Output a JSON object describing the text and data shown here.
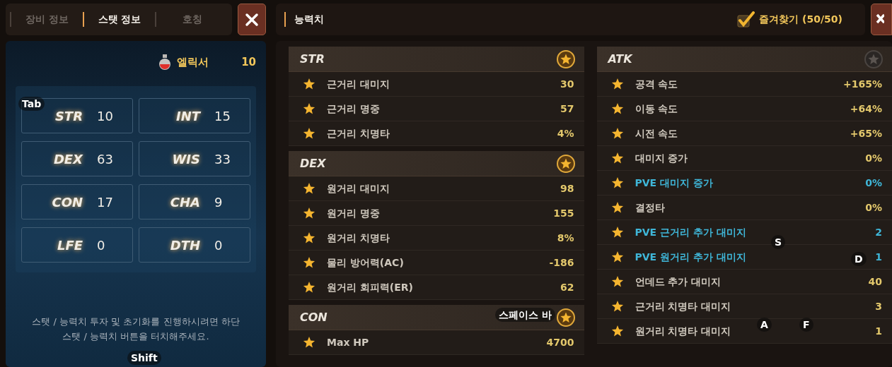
{
  "left_panel": {
    "tabs": [
      {
        "label": "장비 정보",
        "selected": false
      },
      {
        "label": "스탯 정보",
        "selected": true
      },
      {
        "label": "호칭",
        "selected": false
      }
    ],
    "elixir": {
      "label": "엘릭서",
      "count": "10"
    },
    "stats": [
      {
        "name": "STR",
        "value": "10"
      },
      {
        "name": "INT",
        "value": "15"
      },
      {
        "name": "DEX",
        "value": "63"
      },
      {
        "name": "WIS",
        "value": "33"
      },
      {
        "name": "CON",
        "value": "17"
      },
      {
        "name": "CHA",
        "value": "9"
      },
      {
        "name": "LFE",
        "value": "0"
      },
      {
        "name": "DTH",
        "value": "0"
      }
    ],
    "notice": "스탯 / 능력치 투자 및 초기화를 진행하시려면 하단 스탯 / 능력치 버튼을 터치해주세요."
  },
  "right_panel": {
    "title": "능력치",
    "favorites": {
      "label": "즐겨찾기 (50/50)",
      "checked": true
    },
    "columns": [
      [
        {
          "name": "STR",
          "favorite": true,
          "rows": [
            {
              "label": "근거리 대미지",
              "value": "30",
              "kind": "normal"
            },
            {
              "label": "근거리 명중",
              "value": "57",
              "kind": "normal"
            },
            {
              "label": "근거리 치명타",
              "value": "4%",
              "kind": "normal"
            }
          ]
        },
        {
          "name": "DEX",
          "favorite": true,
          "rows": [
            {
              "label": "원거리 대미지",
              "value": "98",
              "kind": "normal"
            },
            {
              "label": "원거리 명중",
              "value": "155",
              "kind": "normal"
            },
            {
              "label": "원거리 치명타",
              "value": "8%",
              "kind": "normal"
            },
            {
              "label": "물리 방어력(AC)",
              "value": "-186",
              "kind": "normal"
            },
            {
              "label": "원거리 회피력(ER)",
              "value": "62",
              "kind": "normal"
            }
          ]
        },
        {
          "name": "CON",
          "favorite": true,
          "rows": [
            {
              "label": "Max HP",
              "value": "4700",
              "kind": "normal"
            }
          ]
        }
      ],
      [
        {
          "name": "ATK",
          "favorite": false,
          "rows": [
            {
              "label": "공격 속도",
              "value": "+165%",
              "kind": "normal"
            },
            {
              "label": "이동 속도",
              "value": "+64%",
              "kind": "normal"
            },
            {
              "label": "시전 속도",
              "value": "+65%",
              "kind": "normal"
            },
            {
              "label": "대미지 증가",
              "value": "0%",
              "kind": "normal"
            },
            {
              "label": "PVE 대미지 증가",
              "value": "0%",
              "kind": "pve"
            },
            {
              "label": "결정타",
              "value": "0%",
              "kind": "normal"
            },
            {
              "label": "PVE 근거리 추가 대미지",
              "value": "2",
              "kind": "pve"
            },
            {
              "label": "PVE 원거리 추가 대미지",
              "value": "1",
              "kind": "pve"
            },
            {
              "label": "언데드 추가 대미지",
              "value": "40",
              "kind": "normal"
            },
            {
              "label": "근거리 치명타 대미지",
              "value": "3",
              "kind": "normal"
            },
            {
              "label": "원거리 치명타 대미지",
              "value": "1",
              "kind": "normal"
            }
          ]
        }
      ]
    ]
  },
  "key_hints": [
    "Tab",
    "Shift",
    "스페이스 바",
    "S",
    "D",
    "A",
    "F"
  ]
}
